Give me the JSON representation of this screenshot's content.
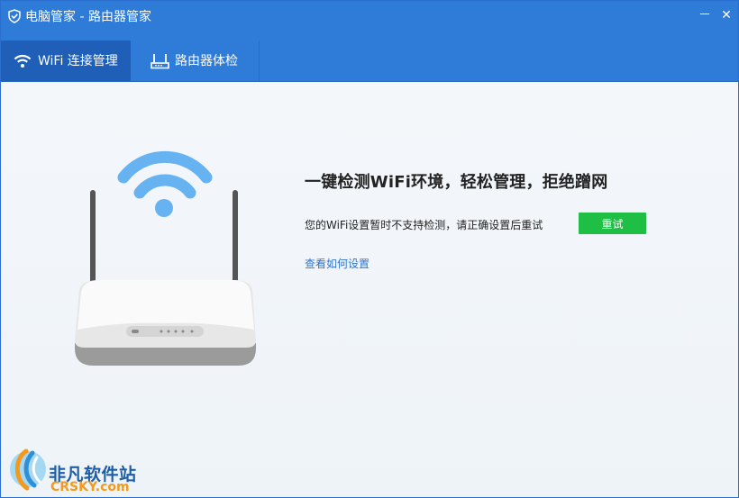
{
  "app": {
    "title": "电脑管家 - 路由器管家",
    "icon": "shield-icon"
  },
  "window_controls": {
    "minimize": "－",
    "close": "✕"
  },
  "tabs": [
    {
      "label": "WiFi 连接管理",
      "icon": "wifi-icon",
      "active": true
    },
    {
      "label": "路由器体检",
      "icon": "router-icon",
      "active": false
    }
  ],
  "main": {
    "headline": "一键检测WiFi环境，轻松管理，拒绝蹭网",
    "message": "您的WiFi设置暂时不支持检测，请正确设置后重试",
    "retry_button": "重试",
    "help_link": "查看如何设置"
  },
  "watermark": {
    "chinese": "非凡软件站",
    "english": "CRSKY.com"
  },
  "colors": {
    "titlebar": "#2e7bd8",
    "active_tab": "#1f5fb7",
    "retry_button": "#1fbf45",
    "link": "#2e74cc",
    "wifi_icon": "#67b2f0"
  }
}
